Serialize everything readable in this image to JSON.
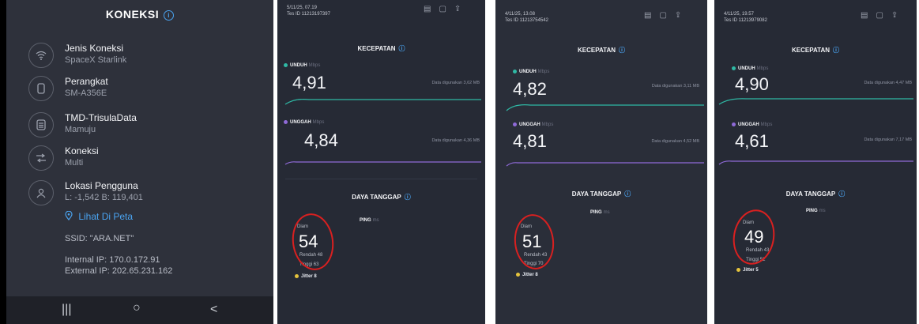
{
  "connection": {
    "title": "KONEKSI",
    "info_icon": "i",
    "items": [
      {
        "icon": "wifi-icon",
        "label": "Jenis Koneksi",
        "value": "SpaceX Starlink"
      },
      {
        "icon": "phone-icon",
        "label": "Perangkat",
        "value": "SM-A356E"
      },
      {
        "icon": "server-icon",
        "label": "TMD-TrisulaData",
        "value": "Mamuju"
      },
      {
        "icon": "multi-connection-icon",
        "label": "Koneksi",
        "value": "Multi"
      },
      {
        "icon": "user-location-icon",
        "label": "Lokasi Pengguna",
        "value": "L: -1,542 B: 119,401"
      }
    ],
    "map_link": "Lihat Di Peta",
    "ssid": "SSID: \"ARA.NET\"",
    "internal_ip": "Internal IP: 170.0.172.91",
    "external_ip": "External IP: 202.65.231.162",
    "nav": {
      "recent": "|||",
      "home": "○",
      "back": "<"
    }
  },
  "tests": [
    {
      "timestamp": "5/11/25, 07.19",
      "test_id": "Tes ID 11213197397",
      "speed_title": "KECEPATAN",
      "download": {
        "label": "UNDUH",
        "unit": "Mbps",
        "value": "4,91",
        "used": "Data digunakan 3,62 MB"
      },
      "upload": {
        "label": "UNGGAH",
        "unit": "Mbps",
        "value": "4,84",
        "used": "Data digunakan 4,36 MB"
      },
      "response_title": "DAYA TANGGAP",
      "ping_label": "PING",
      "ping_unit": "ms",
      "idle_label": "Diam",
      "idle": "54",
      "low": "Rendah 48",
      "high": "Tinggi 63",
      "jitter": "Jitter 8"
    },
    {
      "timestamp": "4/11/25, 13.08",
      "test_id": "Tes ID 11213754542",
      "speed_title": "KECEPATAN",
      "download": {
        "label": "UNDUH",
        "unit": "Mbps",
        "value": "4,82",
        "used": "Data digunakan 3,11 MB"
      },
      "upload": {
        "label": "UNGGAH",
        "unit": "Mbps",
        "value": "4,81",
        "used": "Data digunakan 4,52 MB"
      },
      "response_title": "DAYA TANGGAP",
      "ping_label": "PING",
      "ping_unit": "ms",
      "idle_label": "Diam",
      "idle": "51",
      "low": "Rendah 43",
      "high": "Tinggi 70",
      "jitter": "Jitter 8"
    },
    {
      "timestamp": "4/11/25, 19.57",
      "test_id": "Tes ID 11213979082",
      "speed_title": "KECEPATAN",
      "download": {
        "label": "UNDUH",
        "unit": "Mbps",
        "value": "4,90",
        "used": "Data digunakan 4,47 MB"
      },
      "upload": {
        "label": "UNGGAH",
        "unit": "Mbps",
        "value": "4,61",
        "used": "Data digunakan 7,17 MB"
      },
      "response_title": "DAYA TANGGAP",
      "ping_label": "PING",
      "ping_unit": "ms",
      "idle_label": "Diam",
      "idle": "49",
      "low": "Rendah 43",
      "high": "Tinggi 52",
      "jitter": "Jitter 5"
    }
  ],
  "colors": {
    "download": "#2fb9a5",
    "upload": "#8f6ad8",
    "accent": "#4aa3f0",
    "annotation": "#d92020"
  }
}
